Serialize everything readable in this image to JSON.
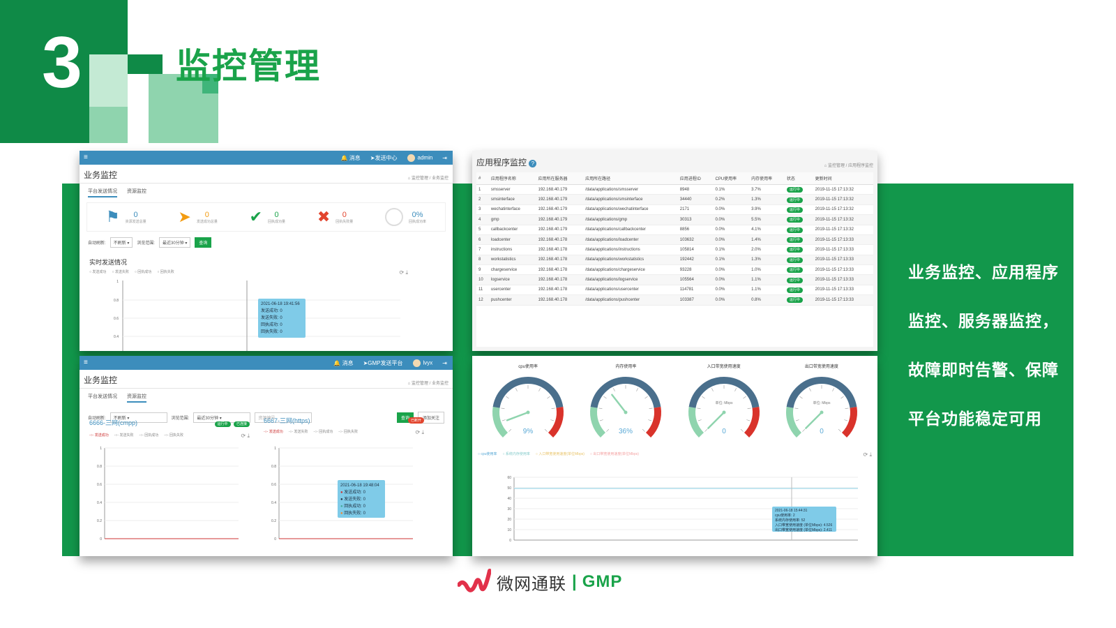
{
  "slide": {
    "number": "3",
    "title": "监控管理",
    "description": "业务监控、应用程序监控、服务器监控，故障即时告警、保障平台功能稳定可用"
  },
  "panel1": {
    "nav": {
      "messages": "消息",
      "send_center": "发送中心",
      "user": "admin"
    },
    "page_title": "业务监控",
    "breadcrumb": [
      "监控管理",
      "业务监控"
    ],
    "tabs": [
      "平台发送情况",
      "资源监控"
    ],
    "stats": [
      {
        "value": "0",
        "label": "资源发送总量",
        "icon": "flag-icon",
        "color": "#3c8dbc"
      },
      {
        "value": "0",
        "label": "发送成功总量",
        "icon": "send-icon",
        "color": "#f39c12"
      },
      {
        "value": "0",
        "label": "回执成功量",
        "icon": "check-icon",
        "color": "#1aa34a"
      },
      {
        "value": "0",
        "label": "回执失败量",
        "icon": "cross-icon",
        "color": "#e2452e"
      },
      {
        "value": "0%",
        "label": "回执成功率",
        "icon": "ring-icon",
        "color": "#dddddd"
      }
    ],
    "filter": {
      "auto_refresh_label": "自动刷新:",
      "auto_refresh_value": "不刷新",
      "range_label": "浏览范围:",
      "range_value": "最近30分钟",
      "query": "查询"
    },
    "chart_title": "实时发送情况",
    "legend": [
      "发送成功",
      "发送失败",
      "回执成功",
      "回执失败"
    ],
    "tooltip": {
      "time": "2021-06-18 19:41:56",
      "lines": [
        "发送成功: 0",
        "发送失败: 0",
        "回执成功: 0",
        "回执失败: 0"
      ]
    },
    "chart_data": {
      "type": "line",
      "yticks": [
        "1",
        "0.8",
        "0.6",
        "0.4"
      ]
    }
  },
  "panel2": {
    "title": "应用程序监控",
    "breadcrumb": [
      "监控管理",
      "应用程序监控"
    ],
    "columns": [
      "#",
      "应用程序名称",
      "应用所在服务器",
      "应用所在路径",
      "应用进程ID",
      "CPU使用率",
      "内存使用率",
      "状态",
      "更新时间"
    ],
    "rows": [
      [
        "1",
        "smsserver",
        "192.168.40.179",
        "/data/applications/smsserver",
        "8948",
        "0.1%",
        "3.7%",
        "运行中",
        "2019-11-15 17:13:32"
      ],
      [
        "2",
        "smsinterface",
        "192.168.40.179",
        "/data/applications/smsinterface",
        "34440",
        "0.2%",
        "1.3%",
        "运行中",
        "2019-11-15 17:13:32"
      ],
      [
        "3",
        "wechatinterface",
        "192.168.40.179",
        "/data/applications/wechatinterface",
        "2171",
        "0.0%",
        "3.9%",
        "运行中",
        "2019-11-15 17:13:32"
      ],
      [
        "4",
        "gmp",
        "192.168.40.179",
        "/data/applications/gmp",
        "30313",
        "0.0%",
        "5.5%",
        "运行中",
        "2019-11-15 17:13:32"
      ],
      [
        "5",
        "callbackcenter",
        "192.168.40.179",
        "/data/applications/callbackcenter",
        "8856",
        "0.0%",
        "4.1%",
        "运行中",
        "2019-11-15 17:13:32"
      ],
      [
        "6",
        "loadcenter",
        "192.168.40.178",
        "/data/applications/loadcenter",
        "103632",
        "0.0%",
        "1.4%",
        "运行中",
        "2019-11-15 17:13:33"
      ],
      [
        "7",
        "instructions",
        "192.168.40.178",
        "/data/applications/instructions",
        "105814",
        "0.1%",
        "2.0%",
        "运行中",
        "2019-11-15 17:13:33"
      ],
      [
        "8",
        "workstatistics",
        "192.168.40.178",
        "/data/applications/workstatistics",
        "192442",
        "0.1%",
        "1.3%",
        "运行中",
        "2019-11-15 17:13:33"
      ],
      [
        "9",
        "chargeservice",
        "192.168.40.178",
        "/data/applications/chargeservice",
        "93228",
        "0.0%",
        "1.0%",
        "运行中",
        "2019-11-15 17:13:33"
      ],
      [
        "10",
        "logservice",
        "192.168.40.178",
        "/data/applications/logservice",
        "105564",
        "0.0%",
        "1.1%",
        "运行中",
        "2019-11-15 17:13:33"
      ],
      [
        "11",
        "usercenter",
        "192.168.40.178",
        "/data/applications/usercenter",
        "114781",
        "0.0%",
        "1.1%",
        "运行中",
        "2019-11-15 17:13:33"
      ],
      [
        "12",
        "pushcenter",
        "192.168.40.178",
        "/data/applications/pushcenter",
        "103387",
        "0.0%",
        "0.8%",
        "运行中",
        "2019-11-15 17:13:33"
      ]
    ]
  },
  "panel3": {
    "nav": {
      "messages": "消息",
      "send_center": "GMP发送平台",
      "user": "lvyx"
    },
    "page_title": "业务监控",
    "breadcrumb": [
      "监控管理",
      "业务监控"
    ],
    "tabs": [
      "平台发送情况",
      "资源监控"
    ],
    "filter": {
      "auto_refresh_label": "自动刷新:",
      "auto_refresh_value": "不刷新",
      "range_label": "浏览范围:",
      "range_value": "最近30分钟",
      "resource_placeholder": "资源编号",
      "query": "查询",
      "follow": "添加关注"
    },
    "cards": [
      {
        "name": "6666-三网(cmpp)",
        "badges": [
          "运行中",
          "已连接"
        ],
        "badge_type": "ok"
      },
      {
        "name": "6667-三网(https)",
        "badges": [
          "已断开"
        ],
        "badge_type": "err"
      }
    ],
    "legend": [
      "发送成功",
      "发送失败",
      "回执成功",
      "回执失败"
    ],
    "yticks": [
      "1",
      "0.8",
      "0.6",
      "0.4",
      "0.2",
      "0"
    ],
    "tooltip": {
      "time": "2021-06-18 19:48:04",
      "lines": [
        "发送成功: 0",
        "发送失败: 0",
        "回执成功: 0",
        "回执失败: 0"
      ]
    }
  },
  "panel4": {
    "gauges": [
      {
        "title": "cpu使用率",
        "value": 9,
        "display": "9%",
        "unit": ""
      },
      {
        "title": "内存使用率",
        "value": 36,
        "display": "36%",
        "unit": ""
      },
      {
        "title": "入口带宽使用速度",
        "value": 0,
        "display": "0",
        "unit": "单位: Mbps"
      },
      {
        "title": "出口带宽使用速度",
        "value": 0,
        "display": "0",
        "unit": "单位: Mbps"
      }
    ],
    "legend": [
      "cpu使用率",
      "系统内存使用率",
      "入口带宽使用速度(单位Mbps)",
      "出口带宽使用速度(单位Mbps)"
    ],
    "tooltip": {
      "time": "2021-06-18 15:44:31",
      "lines": [
        "cpu使用率: 2",
        "系统内存使用率: 52",
        "入口带宽使用速度 (单位Mbps): 4.526",
        "出口带宽使用速度 (单位Mbps): 2.411"
      ]
    },
    "yticks": [
      "60",
      "50",
      "40",
      "30",
      "20",
      "10",
      "0"
    ]
  },
  "logo": {
    "name": "微网通联",
    "separator": "|",
    "brand": "GMP"
  }
}
